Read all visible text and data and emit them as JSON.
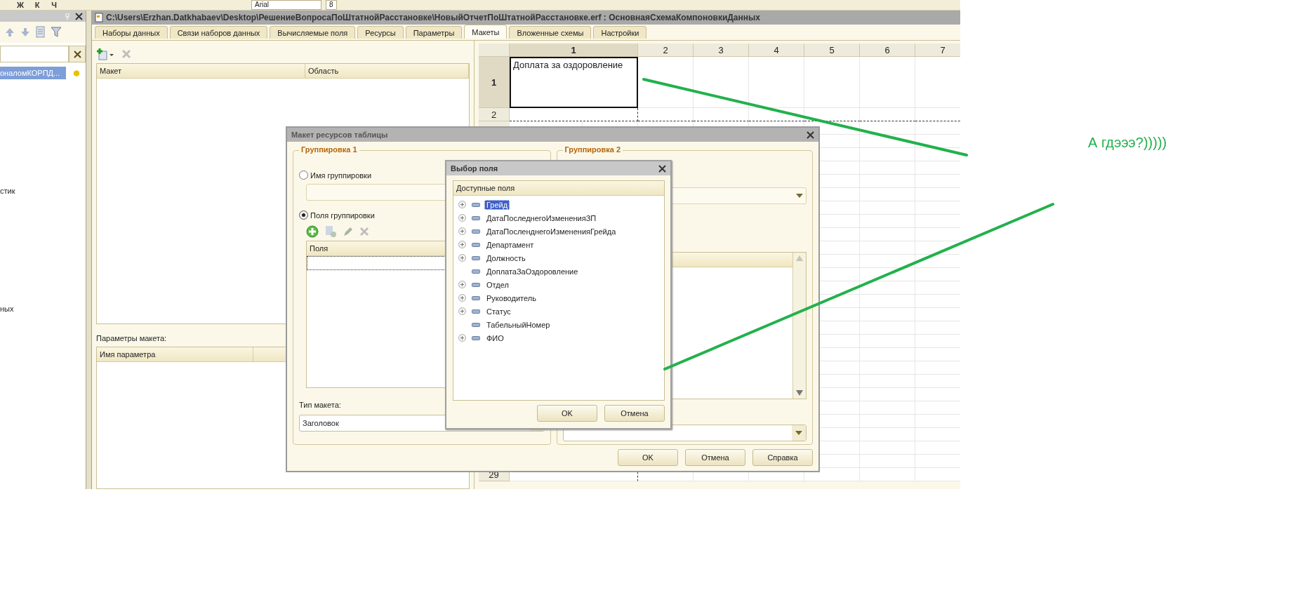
{
  "toolbar": {
    "format_buttons": [
      "Ж",
      "К",
      "Ч"
    ],
    "font_field": "Arial",
    "size_field": "8"
  },
  "left_panel": {
    "items": [
      {
        "label": "оналомКОРПД...",
        "selected": true
      },
      {
        "label": "стик",
        "selected": false
      },
      {
        "label": "ных",
        "selected": false
      }
    ]
  },
  "window": {
    "title": "C:\\Users\\Erzhan.Datkhabaev\\Desktop\\РешениеВопросаПоШтатнойРасстановке\\НовыйОтчетПоШтатнойРасстановке.erf : ОсновнаяСхемаКомпоновкиДанных",
    "tabs": [
      {
        "label": "Наборы данных",
        "selected": false
      },
      {
        "label": "Связи наборов данных",
        "selected": false
      },
      {
        "label": "Вычисляемые поля",
        "selected": false
      },
      {
        "label": "Ресурсы",
        "selected": false
      },
      {
        "label": "Параметры",
        "selected": false
      },
      {
        "label": "Макеты",
        "selected": true
      },
      {
        "label": "Вложенные схемы",
        "selected": false
      },
      {
        "label": "Настройки",
        "selected": false
      }
    ]
  },
  "layouts_table": {
    "columns": [
      "Макет",
      "Область"
    ]
  },
  "layout_params": {
    "label": "Параметры макета:",
    "columns": [
      "Имя параметра"
    ]
  },
  "sheet": {
    "columns": [
      {
        "label": "1",
        "selected": true
      },
      {
        "label": "2",
        "selected": false
      },
      {
        "label": "3",
        "selected": false
      },
      {
        "label": "4",
        "selected": false
      },
      {
        "label": "5",
        "selected": false
      },
      {
        "label": "6",
        "selected": false
      },
      {
        "label": "7",
        "selected": false
      }
    ],
    "rows": [
      {
        "header": "1",
        "selected": true,
        "text": "Доплата за оздоровление"
      },
      {
        "header": "2",
        "selected": false
      },
      {
        "header": "29",
        "selected": false
      }
    ]
  },
  "dialog": {
    "title": "Макет ресурсов таблицы",
    "group_1": {
      "title": "Группировка 1",
      "radios": [
        {
          "label": "Имя группировки",
          "selected": false
        },
        {
          "label": "Поля группировки",
          "selected": true
        }
      ],
      "table_column": "Поля",
      "type_label": "Тип макета:",
      "type_value": "Заголовок"
    },
    "group_2": {
      "title": "Группировка 2"
    },
    "buttons": [
      "OK",
      "Отмена",
      "Справка"
    ]
  },
  "picker": {
    "title": "Выбор поля",
    "header": "Доступные поля",
    "items": [
      {
        "label": "Грейд",
        "expandable": true,
        "selected": true
      },
      {
        "label": "ДатаПоследнегоИзмененияЗП",
        "expandable": true,
        "selected": false
      },
      {
        "label": "ДатаПосленднегоИзмененияГрейда",
        "expandable": true,
        "selected": false
      },
      {
        "label": "Департамент",
        "expandable": true,
        "selected": false
      },
      {
        "label": "Должность",
        "expandable": true,
        "selected": false
      },
      {
        "label": "ДоплатаЗаОздоровление",
        "expandable": false,
        "selected": false
      },
      {
        "label": "Отдел",
        "expandable": true,
        "selected": false
      },
      {
        "label": "Руководитель",
        "expandable": true,
        "selected": false
      },
      {
        "label": "Статус",
        "expandable": true,
        "selected": false
      },
      {
        "label": "ТабельныйНомер",
        "expandable": false,
        "selected": false
      },
      {
        "label": "ФИО",
        "expandable": true,
        "selected": false
      }
    ],
    "buttons": [
      "OK",
      "Отмена"
    ]
  },
  "annotation": {
    "text": "А гдэээ?)))))"
  }
}
